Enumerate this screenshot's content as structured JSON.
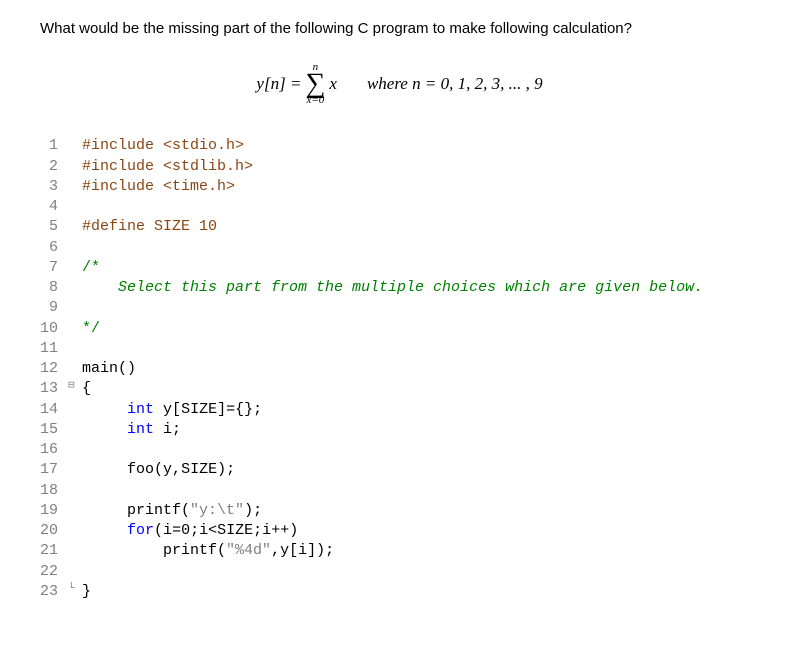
{
  "question": "What would be the missing part of the following C program to make following calculation?",
  "formula": {
    "lhs": "y[n] = ",
    "sigma_top": "n",
    "sigma_bottom": "x=0",
    "sigma_var": "x",
    "where": "where n = 0, 1, 2, 3, ... , 9"
  },
  "code": {
    "lines": [
      {
        "num": "1",
        "fold": "",
        "segments": [
          {
            "cls": "preprocessor",
            "text": "#include "
          },
          {
            "cls": "include-path",
            "text": "<stdio.h>"
          }
        ]
      },
      {
        "num": "2",
        "fold": "",
        "segments": [
          {
            "cls": "preprocessor",
            "text": "#include "
          },
          {
            "cls": "include-path",
            "text": "<stdlib.h>"
          }
        ]
      },
      {
        "num": "3",
        "fold": "",
        "segments": [
          {
            "cls": "preprocessor",
            "text": "#include "
          },
          {
            "cls": "include-path",
            "text": "<time.h>"
          }
        ]
      },
      {
        "num": "4",
        "fold": "",
        "segments": []
      },
      {
        "num": "5",
        "fold": "",
        "segments": [
          {
            "cls": "preprocessor",
            "text": "#define SIZE 10"
          }
        ]
      },
      {
        "num": "6",
        "fold": "",
        "segments": []
      },
      {
        "num": "7",
        "fold": "",
        "segments": [
          {
            "cls": "comment",
            "text": "/*"
          }
        ]
      },
      {
        "num": "8",
        "fold": "",
        "segments": [
          {
            "cls": "comment-italic",
            "text": "    Select this part from the multiple choices which are given below."
          }
        ]
      },
      {
        "num": "9",
        "fold": "",
        "segments": []
      },
      {
        "num": "10",
        "fold": "",
        "segments": [
          {
            "cls": "comment",
            "text": "*/"
          }
        ]
      },
      {
        "num": "11",
        "fold": "",
        "segments": []
      },
      {
        "num": "12",
        "fold": "",
        "segments": [
          {
            "cls": "function-name",
            "text": "main"
          },
          {
            "cls": "brace",
            "text": "()"
          }
        ]
      },
      {
        "num": "13",
        "fold": "⊟",
        "segments": [
          {
            "cls": "brace",
            "text": "{"
          }
        ]
      },
      {
        "num": "14",
        "fold": "",
        "segments": [
          {
            "cls": "identifier",
            "text": "     "
          },
          {
            "cls": "keyword",
            "text": "int"
          },
          {
            "cls": "identifier",
            "text": " y"
          },
          {
            "cls": "brace",
            "text": "["
          },
          {
            "cls": "identifier",
            "text": "SIZE"
          },
          {
            "cls": "brace",
            "text": "]"
          },
          {
            "cls": "operator",
            "text": "="
          },
          {
            "cls": "brace",
            "text": "{}"
          },
          {
            "cls": "operator",
            "text": ";"
          }
        ]
      },
      {
        "num": "15",
        "fold": "",
        "segments": [
          {
            "cls": "identifier",
            "text": "     "
          },
          {
            "cls": "keyword",
            "text": "int"
          },
          {
            "cls": "identifier",
            "text": " i"
          },
          {
            "cls": "operator",
            "text": ";"
          }
        ]
      },
      {
        "num": "16",
        "fold": "",
        "segments": []
      },
      {
        "num": "17",
        "fold": "",
        "segments": [
          {
            "cls": "identifier",
            "text": "     foo"
          },
          {
            "cls": "brace",
            "text": "("
          },
          {
            "cls": "identifier",
            "text": "y"
          },
          {
            "cls": "operator",
            "text": ","
          },
          {
            "cls": "identifier",
            "text": "SIZE"
          },
          {
            "cls": "brace",
            "text": ")"
          },
          {
            "cls": "operator",
            "text": ";"
          }
        ]
      },
      {
        "num": "18",
        "fold": "",
        "segments": []
      },
      {
        "num": "19",
        "fold": "",
        "segments": [
          {
            "cls": "identifier",
            "text": "     printf"
          },
          {
            "cls": "brace",
            "text": "("
          },
          {
            "cls": "string",
            "text": "\"y:\\t\""
          },
          {
            "cls": "brace",
            "text": ")"
          },
          {
            "cls": "operator",
            "text": ";"
          }
        ]
      },
      {
        "num": "20",
        "fold": "",
        "segments": [
          {
            "cls": "identifier",
            "text": "     "
          },
          {
            "cls": "keyword",
            "text": "for"
          },
          {
            "cls": "brace",
            "text": "("
          },
          {
            "cls": "identifier",
            "text": "i"
          },
          {
            "cls": "operator",
            "text": "="
          },
          {
            "cls": "number",
            "text": "0"
          },
          {
            "cls": "operator",
            "text": ";"
          },
          {
            "cls": "identifier",
            "text": "i"
          },
          {
            "cls": "operator",
            "text": "<"
          },
          {
            "cls": "identifier",
            "text": "SIZE"
          },
          {
            "cls": "operator",
            "text": ";"
          },
          {
            "cls": "identifier",
            "text": "i"
          },
          {
            "cls": "operator",
            "text": "++"
          },
          {
            "cls": "brace",
            "text": ")"
          }
        ]
      },
      {
        "num": "21",
        "fold": "",
        "segments": [
          {
            "cls": "identifier",
            "text": "         printf"
          },
          {
            "cls": "brace",
            "text": "("
          },
          {
            "cls": "string",
            "text": "\"%4d\""
          },
          {
            "cls": "operator",
            "text": ","
          },
          {
            "cls": "identifier",
            "text": "y"
          },
          {
            "cls": "brace",
            "text": "["
          },
          {
            "cls": "identifier",
            "text": "i"
          },
          {
            "cls": "brace",
            "text": "]"
          },
          {
            "cls": "brace",
            "text": ")"
          },
          {
            "cls": "operator",
            "text": ";"
          }
        ]
      },
      {
        "num": "22",
        "fold": "",
        "segments": []
      },
      {
        "num": "23",
        "fold": "└",
        "segments": [
          {
            "cls": "brace",
            "text": "}"
          }
        ]
      }
    ]
  }
}
